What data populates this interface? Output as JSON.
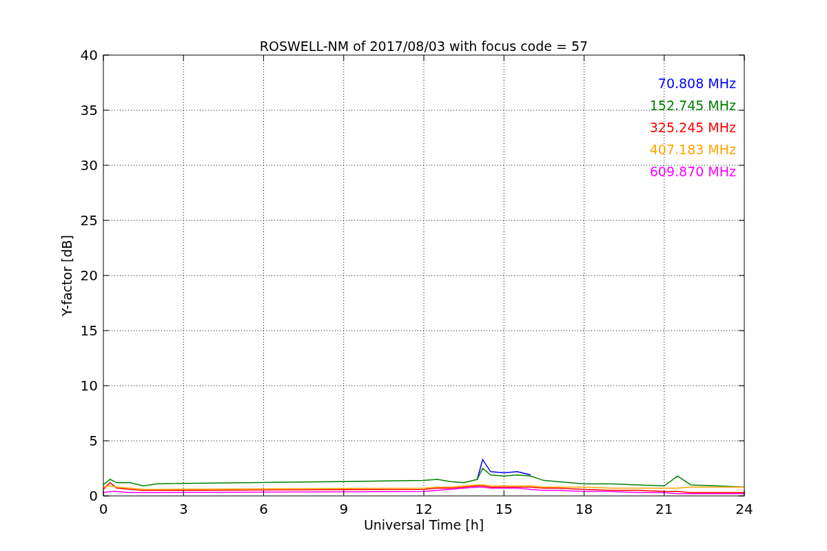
{
  "chart_data": {
    "type": "line",
    "title": "ROSWELL-NM of 2017/08/03 with focus code = 57",
    "xlabel": "Universal Time [h]",
    "ylabel": "Y-factor [dB]",
    "x": [
      0,
      0.25,
      0.5,
      1,
      1.5,
      2,
      12,
      12.5,
      13,
      13.5,
      14,
      14.2,
      14.5,
      15,
      15.5,
      16,
      16.5,
      17,
      18,
      19,
      20,
      21,
      21.5,
      22,
      23,
      24
    ],
    "series": [
      {
        "name": "70.808 MHz",
        "color": "#0000ff",
        "values": [
          null,
          null,
          null,
          null,
          null,
          null,
          null,
          null,
          null,
          null,
          1.5,
          3.3,
          2.2,
          2.1,
          2.2,
          1.9,
          null,
          null,
          null,
          null,
          null,
          null,
          null,
          null,
          null,
          null
        ]
      },
      {
        "name": "152.745 MHz",
        "color": "#008000",
        "values": [
          1.0,
          1.5,
          1.2,
          1.2,
          0.9,
          1.1,
          1.4,
          1.5,
          1.3,
          1.2,
          1.5,
          2.5,
          1.9,
          1.8,
          1.9,
          1.8,
          1.4,
          1.3,
          1.1,
          1.1,
          1.0,
          0.9,
          1.8,
          1.0,
          0.9,
          0.8
        ]
      },
      {
        "name": "325.245 MHz",
        "color": "#ff0000",
        "values": [
          0.6,
          1.2,
          0.7,
          0.6,
          0.5,
          0.5,
          0.6,
          0.7,
          0.7,
          0.8,
          0.9,
          0.9,
          0.8,
          0.8,
          0.8,
          0.8,
          0.7,
          0.7,
          0.6,
          0.5,
          0.5,
          0.4,
          0.4,
          0.3,
          0.3,
          0.3
        ]
      },
      {
        "name": "407.183 MHz",
        "color": "#ffa500",
        "values": [
          0.8,
          0.9,
          0.8,
          0.7,
          0.6,
          0.6,
          0.7,
          0.8,
          0.8,
          0.9,
          1.0,
          1.0,
          0.9,
          0.9,
          0.9,
          0.9,
          0.8,
          0.8,
          0.8,
          0.7,
          0.7,
          0.7,
          0.7,
          0.8,
          0.8,
          0.8
        ]
      },
      {
        "name": "609.870 MHz",
        "color": "#ff00ff",
        "values": [
          0.3,
          0.4,
          0.4,
          0.3,
          0.3,
          0.3,
          0.4,
          0.5,
          0.6,
          0.7,
          0.8,
          0.8,
          0.7,
          0.7,
          0.7,
          0.6,
          0.5,
          0.5,
          0.4,
          0.4,
          0.3,
          0.3,
          0.2,
          0.2,
          0.2,
          0.2
        ]
      }
    ],
    "grid": true,
    "xlim": [
      0,
      24
    ],
    "ylim": [
      0,
      40
    ],
    "xticks": [
      0,
      3,
      6,
      9,
      12,
      15,
      18,
      21,
      24
    ],
    "yticks": [
      0,
      5,
      10,
      15,
      20,
      25,
      30,
      35,
      40
    ]
  }
}
